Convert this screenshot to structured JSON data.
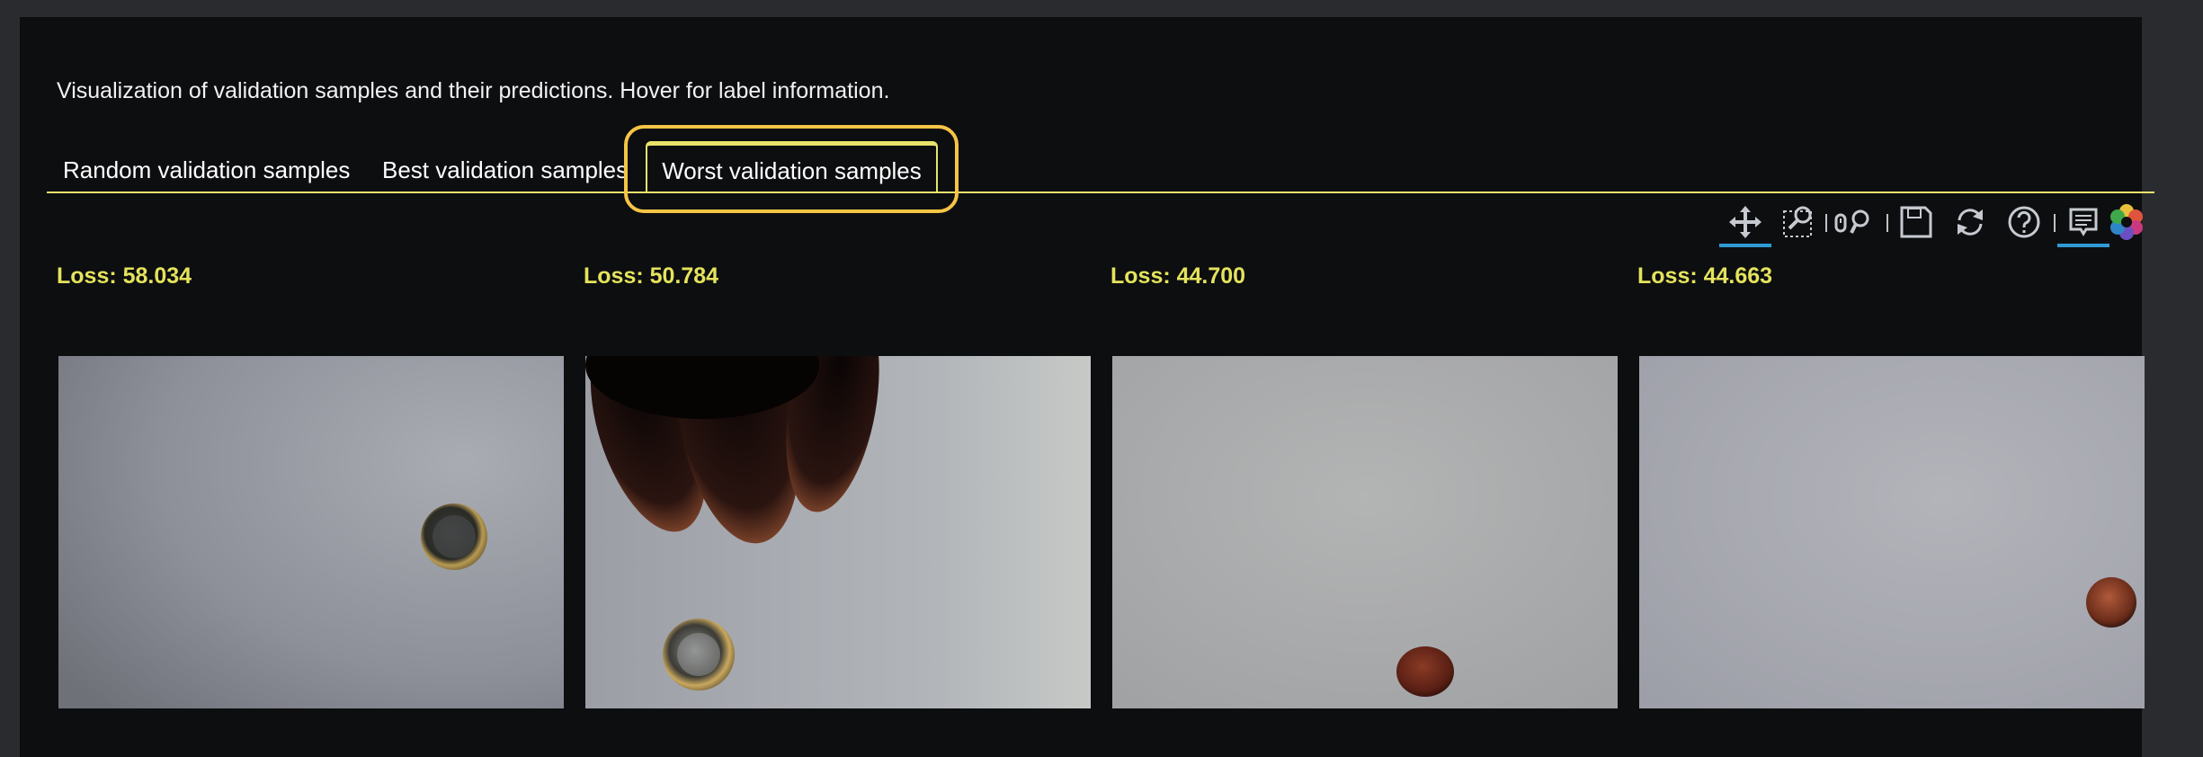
{
  "description": "Visualization of validation samples and their predictions. Hover for label information.",
  "tabs": [
    {
      "label": "Random validation samples",
      "active": false
    },
    {
      "label": "Best validation samples",
      "active": false
    },
    {
      "label": "Worst validation samples",
      "active": true
    }
  ],
  "toolbar": {
    "tools": [
      {
        "icon": "pan-icon",
        "active": true
      },
      {
        "icon": "box-zoom-icon",
        "active": false
      },
      {
        "icon": "wheel-zoom-icon",
        "active": false
      },
      {
        "icon": "save-icon",
        "active": false
      },
      {
        "icon": "reset-icon",
        "active": false
      },
      {
        "icon": "help-icon",
        "active": false
      },
      {
        "icon": "hover-tooltip-icon",
        "active": true
      },
      {
        "icon": "bokeh-logo-icon",
        "active": false
      }
    ]
  },
  "samples": [
    {
      "loss_label": "Loss: 58.034",
      "object": "silver-coin"
    },
    {
      "loss_label": "Loss: 50.784",
      "object": "silver-coin-with-fingers"
    },
    {
      "loss_label": "Loss: 44.700",
      "object": "copper-coin"
    },
    {
      "loss_label": "Loss: 44.663",
      "object": "copper-coin"
    }
  ],
  "colors": {
    "accent": "#e8e36a",
    "loss_text": "#e4e35c",
    "highlight": "#f6c445",
    "active_tool": "#2f9bd6",
    "background": "#0d0e10"
  }
}
